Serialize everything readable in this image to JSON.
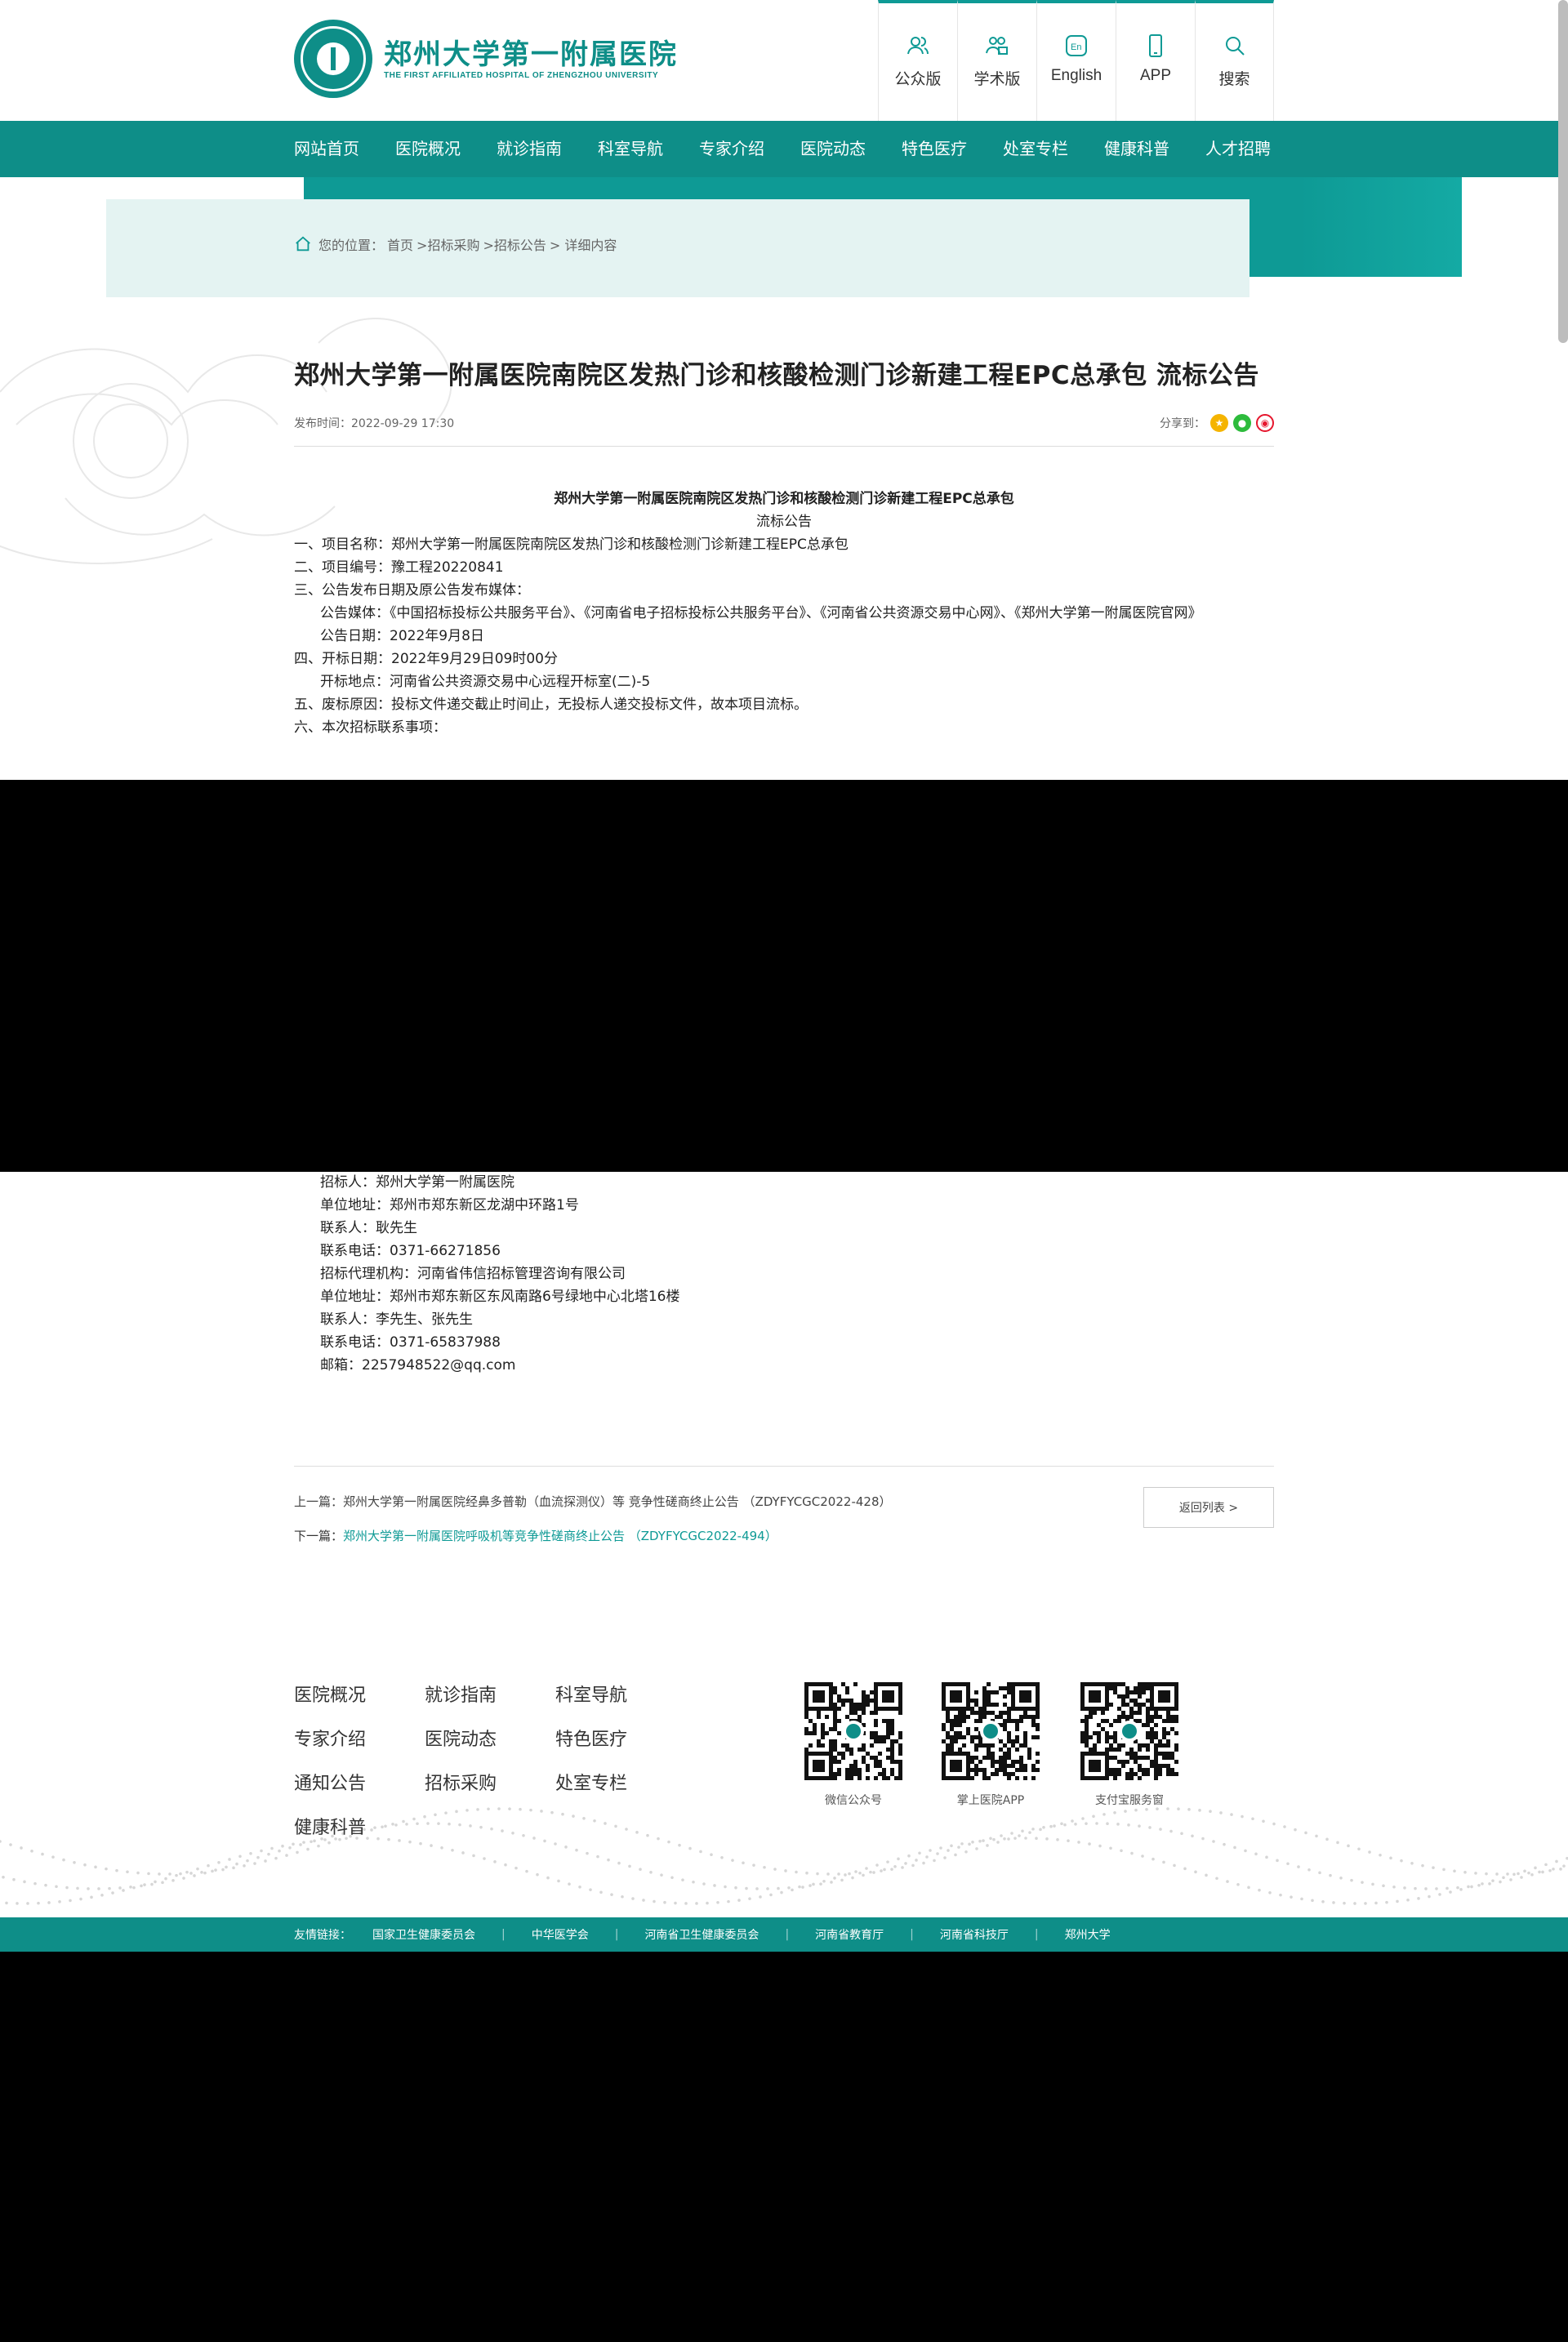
{
  "header": {
    "logo_cn": "郑州大学第一附属医院",
    "logo_en": "THE FIRST AFFILIATED HOSPITAL OF ZHENGZHOU UNIVERSITY",
    "quick": [
      {
        "label": "公众版",
        "icon": "users-icon"
      },
      {
        "label": "学术版",
        "icon": "academic-icon"
      },
      {
        "label": "English",
        "icon": "en-icon"
      },
      {
        "label": "APP",
        "icon": "phone-icon"
      },
      {
        "label": "搜索",
        "icon": "search-icon"
      }
    ]
  },
  "nav": [
    "网站首页",
    "医院概况",
    "就诊指南",
    "科室导航",
    "专家介绍",
    "医院动态",
    "特色医疗",
    "处室专栏",
    "健康科普",
    "人才招聘"
  ],
  "breadcrumb": {
    "prefix": "您的位置：",
    "home": "首页",
    "path1": ">招标采购",
    "path2": ">招标公告",
    "path3": "> 详细内容"
  },
  "article": {
    "title": "郑州大学第一附属医院南院区发热门诊和核酸检测门诊新建工程EPC总承包 流标公告",
    "publish": "发布时间：2022-09-29 17:30",
    "share_label": "分享到：",
    "heading1": "郑州大学第一附属医院南院区发热门诊和核酸检测门诊新建工程EPC总承包",
    "heading2": "流标公告",
    "lines": [
      "一、项目名称：郑州大学第一附属医院南院区发热门诊和核酸检测门诊新建工程EPC总承包",
      "二、项目编号：豫工程20220841",
      "三、公告发布日期及原公告发布媒体：",
      "公告媒体：《中国招标投标公共服务平台》、《河南省电子招标投标公共服务平台》、《河南省公共资源交易中心网》、《郑州大学第一附属医院官网》",
      "公告日期：2022年9月8日",
      "四、开标日期：2022年9月29日09时00分",
      "开标地点：河南省公共资源交易中心远程开标室(二)-5",
      "五、废标原因：投标文件递交截止时间止，无投标人递交投标文件，故本项目流标。",
      "六、本次招标联系事项："
    ],
    "contacts": [
      "招标人：郑州大学第一附属医院",
      "单位地址：郑州市郑东新区龙湖中环路1号",
      "联系人：耿先生",
      "联系电话：0371-66271856",
      "招标代理机构：河南省伟信招标管理咨询有限公司",
      "单位地址：郑州市郑东新区东风南路6号绿地中心北塔16楼",
      "联系人：李先生、张先生",
      "联系电话：0371-65837988",
      "邮箱：2257948522@qq.com"
    ],
    "prev_label": "上一篇：",
    "prev": "郑州大学第一附属医院经鼻多普勒（血流探测仪）等 竞争性磋商终止公告 （ZDYFYCGC2022-428）",
    "next_label": "下一篇：",
    "next": "郑州大学第一附属医院呼吸机等竞争性磋商终止公告 （ZDYFYCGC2022-494）",
    "back": "返回列表 >"
  },
  "footer": {
    "links": [
      "医院概况",
      "就诊指南",
      "科室导航",
      "专家介绍",
      "医院动态",
      "特色医疗",
      "通知公告",
      "招标采购",
      "处室专栏",
      "健康科普"
    ],
    "qrs": [
      "微信公众号",
      "掌上医院APP",
      "支付宝服务窗"
    ],
    "friends_label": "友情链接：",
    "friends": [
      "国家卫生健康委员会",
      "中华医学会",
      "河南省卫生健康委员会",
      "河南省教育厅",
      "河南省科技厅",
      "郑州大学"
    ]
  },
  "colors": {
    "brand": "#0e8e88",
    "accent": "#0e9a95",
    "light": "#e4f3f2"
  }
}
